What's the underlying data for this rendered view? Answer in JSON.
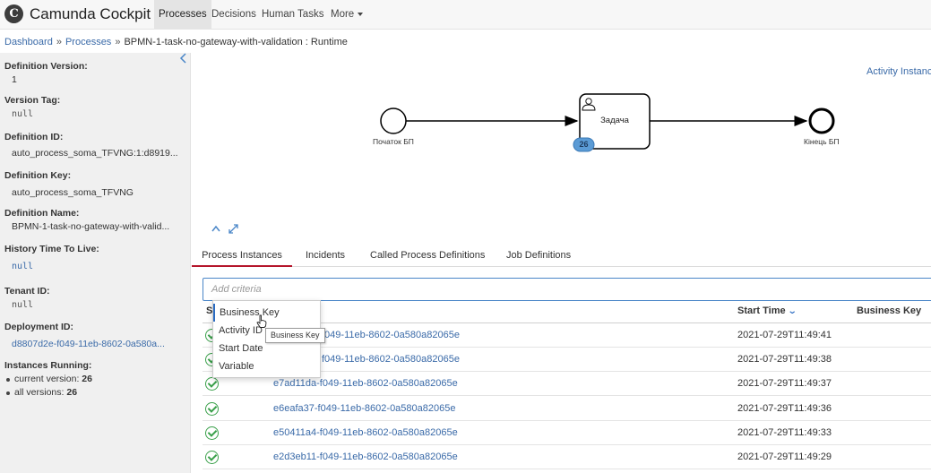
{
  "app": {
    "brand": "Camunda Cockpit",
    "nav": [
      "Processes",
      "Decisions",
      "Human Tasks",
      "More"
    ]
  },
  "breadcrumb": {
    "dashboard": "Dashboard",
    "separator": "»",
    "processes": "Processes",
    "current": "BPMN-1-task-no-gateway-with-validation : Runtime"
  },
  "sidebar": {
    "definition_version_label": "Definition Version:",
    "definition_version": "1",
    "version_tag_label": "Version Tag:",
    "version_tag": "null",
    "definition_id_label": "Definition ID:",
    "definition_id": "auto_process_soma_TFVNG:1:d8919...",
    "definition_key_label": "Definition Key:",
    "definition_key": "auto_process_soma_TFVNG",
    "definition_name_label": "Definition Name:",
    "definition_name": "BPMN-1-task-no-gateway-with-valid...",
    "history_ttl_label": "History Time To Live:",
    "history_ttl": "null",
    "tenant_id_label": "Tenant ID:",
    "tenant_id": "null",
    "deployment_id_label": "Deployment ID:",
    "deployment_id": "d8807d2e-f049-11eb-8602-0a580a...",
    "instances_running_label": "Instances Running:",
    "current_version_label": "current version:",
    "current_version_count": "26",
    "all_versions_label": "all versions:",
    "all_versions_count": "26"
  },
  "diagram": {
    "start_label": "Початок БП",
    "task_label": "Задача",
    "task_badge": "26",
    "end_label": "Кінець БП",
    "activity_instance_link": "Activity Instanc"
  },
  "tabs": [
    "Process Instances",
    "Incidents",
    "Called Process Definitions",
    "Job Definitions"
  ],
  "search": {
    "placeholder": "Add criteria"
  },
  "table": {
    "headers": {
      "state": "S",
      "start_time": "Start Time",
      "business_key": "Business Key"
    },
    "rows": [
      {
        "id": "f049-11eb-8602-0a580a82065e",
        "start_time": "2021-07-29T11:49:41"
      },
      {
        "id": "f049-11eb-8602-0a580a82065e",
        "start_time": "2021-07-29T11:49:38"
      },
      {
        "id": "e7ad11da-f049-11eb-8602-0a580a82065e",
        "start_time": "2021-07-29T11:49:37"
      },
      {
        "id": "e6eafa37-f049-11eb-8602-0a580a82065e",
        "start_time": "2021-07-29T11:49:36"
      },
      {
        "id": "e50411a4-f049-11eb-8602-0a580a82065e",
        "start_time": "2021-07-29T11:49:33"
      },
      {
        "id": "e2d3eb11-f049-11eb-8602-0a580a82065e",
        "start_time": "2021-07-29T11:49:29"
      }
    ]
  },
  "dropdown": {
    "options": [
      "Business Key",
      "Activity ID",
      "Start Date",
      "Variable"
    ],
    "tooltip": "Business Key"
  },
  "colors": {
    "accent": "#b5152b",
    "link": "#3a6aa8",
    "success": "#3aa04a"
  }
}
